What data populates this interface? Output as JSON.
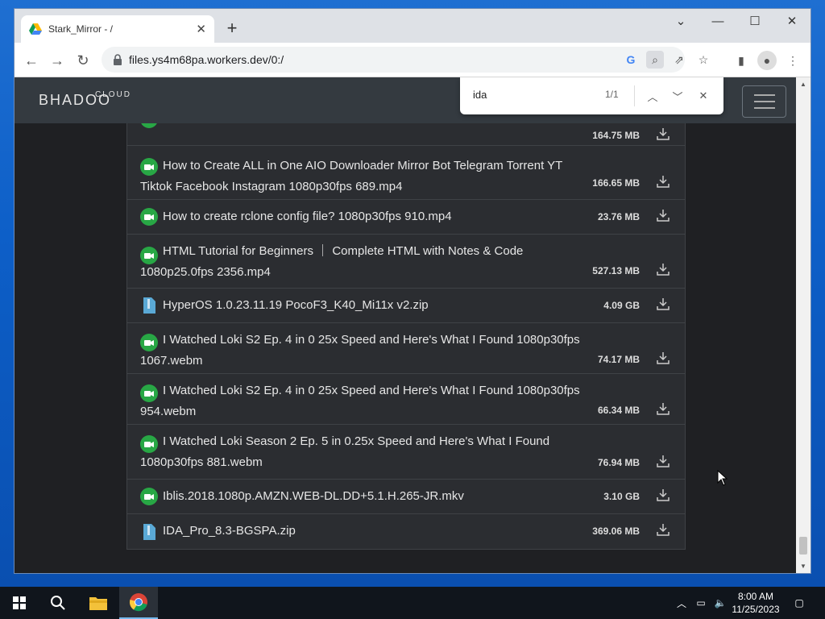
{
  "browser": {
    "tab_title": "Stark_Mirror - /",
    "url": "files.ys4m68pa.workers.dev/0:/"
  },
  "site": {
    "logo_top": "CLOUD",
    "logo_main": "BHADOO"
  },
  "find": {
    "query": "ida",
    "count": "1/1"
  },
  "files": [
    {
      "name": "",
      "size": "164.75 MB",
      "type": "video",
      "icon": "video-icon"
    },
    {
      "name": "How to Create ALL in One AIO Downloader Mirror Bot Telegram Torrent YT Tiktok Facebook Instagram 1080p30fps 689.mp4",
      "size": "166.65 MB",
      "type": "video",
      "icon": "video-icon"
    },
    {
      "name": "How to create rclone config file?  1080p30fps 910.mp4",
      "size": "23.76 MB",
      "type": "video",
      "icon": "video-icon"
    },
    {
      "name": "HTML Tutorial for Beginners ｜ Complete HTML with Notes & Code 1080p25.0fps 2356.mp4",
      "size": "527.13 MB",
      "type": "video",
      "icon": "video-icon"
    },
    {
      "name": "HyperOS 1.0.23.11.19 PocoF3_K40_Mi11x v2.zip",
      "size": "4.09 GB",
      "type": "archive",
      "icon": "zip-file-icon"
    },
    {
      "name": "I Watched Loki S2 Ep. 4 in 0 25x Speed and Here's What I Found 1080p30fps 1067.webm",
      "size": "74.17 MB",
      "type": "video",
      "icon": "video-icon"
    },
    {
      "name": "I Watched Loki S2 Ep. 4 in 0 25x Speed and Here's What I Found 1080p30fps 954.webm",
      "size": "66.34 MB",
      "type": "video",
      "icon": "video-icon"
    },
    {
      "name": "I Watched Loki Season 2 Ep. 5 in 0.25x Speed and Here's What I Found 1080p30fps 881.webm",
      "size": "76.94 MB",
      "type": "video",
      "icon": "video-icon"
    },
    {
      "name": "Iblis.2018.1080p.AMZN.WEB-DL.DD+5.1.H.265-JR.mkv",
      "size": "3.10 GB",
      "type": "video",
      "icon": "video-icon"
    },
    {
      "name": "IDA_Pro_8.3-BGSPA.zip",
      "size": "369.06 MB",
      "type": "archive",
      "icon": "zip-file-icon"
    }
  ],
  "taskbar": {
    "time": "8:00 AM",
    "date": "11/25/2023"
  },
  "colors": {
    "video_icon": "#28a745",
    "page_bg": "#1f2023",
    "row_bg": "#2b2d31",
    "header_bg": "#343a40",
    "archive_icon": "#5aa9d6"
  }
}
